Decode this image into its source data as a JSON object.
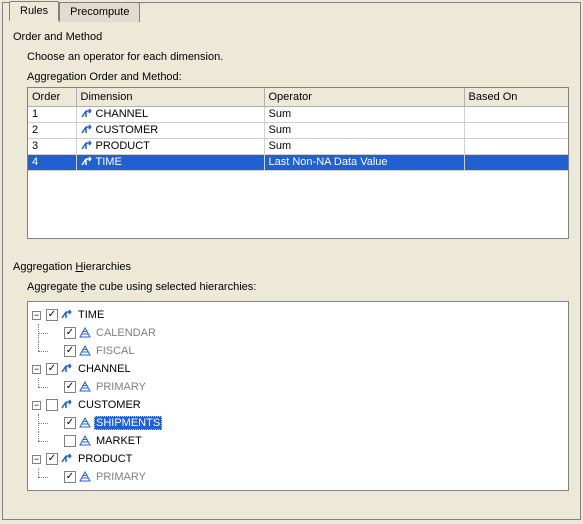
{
  "tabs": {
    "rules": "Rules",
    "precompute": "Precompute"
  },
  "order_method": {
    "title": "Order and Method",
    "instruction": "Choose an operator for each dimension.",
    "table_label_pre": "A",
    "table_label_key": "g",
    "table_label_post": "gregation Order and Method:",
    "columns": {
      "order": "Order",
      "dimension": "Dimension",
      "operator": "Operator",
      "based_on": "Based On"
    },
    "rows": [
      {
        "order": "1",
        "dimension": "CHANNEL",
        "operator": "Sum",
        "based_on": ""
      },
      {
        "order": "2",
        "dimension": "CUSTOMER",
        "operator": "Sum",
        "based_on": ""
      },
      {
        "order": "3",
        "dimension": "PRODUCT",
        "operator": "Sum",
        "based_on": ""
      },
      {
        "order": "4",
        "dimension": "TIME",
        "operator": "Last Non-NA Data Value",
        "based_on": ""
      }
    ]
  },
  "hierarchies": {
    "title_pre": "Aggregation ",
    "title_key": "H",
    "title_post": "ierarchies",
    "instruction_pre": "Aggregate ",
    "instruction_key": "t",
    "instruction_post": "he cube using selected hierarchies:",
    "tree": {
      "time": {
        "label": "TIME",
        "checked": true,
        "children": {
          "calendar": {
            "label": "CALENDAR",
            "checked": true,
            "disabled": true
          },
          "fiscal": {
            "label": "FISCAL",
            "checked": true,
            "disabled": true
          }
        }
      },
      "channel": {
        "label": "CHANNEL",
        "checked": true,
        "children": {
          "primary": {
            "label": "PRIMARY",
            "checked": true,
            "disabled": true
          }
        }
      },
      "customer": {
        "label": "CUSTOMER",
        "checked": false,
        "children": {
          "shipments": {
            "label": "SHIPMENTS",
            "checked": true,
            "selected": true
          },
          "market": {
            "label": "MARKET",
            "checked": false
          }
        }
      },
      "product": {
        "label": "PRODUCT",
        "checked": true,
        "children": {
          "primary": {
            "label": "PRIMARY",
            "checked": true,
            "disabled": true
          }
        }
      }
    }
  }
}
